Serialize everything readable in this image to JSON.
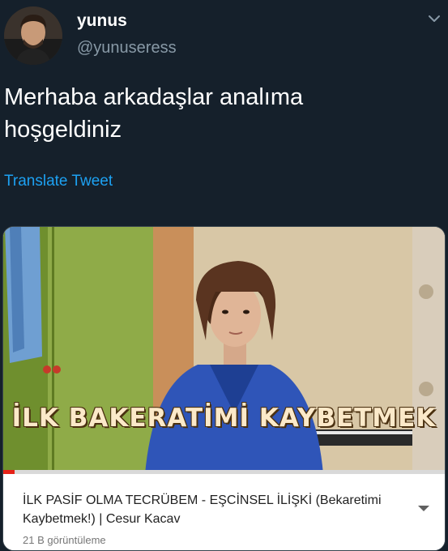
{
  "tweet": {
    "author_name": "yunus",
    "author_handle": "@yunuseress",
    "text": "Merhaba arkadaşlar analıma hoşgeldiniz",
    "translate_label": "Translate Tweet"
  },
  "video_card": {
    "thumbnail_caption": "İLK BAKERATİMİ KAYBETMEK",
    "title": "İLK PASİF OLMA TECRÜBEM - EŞCİNSEL İLİŞKİ (Bekaretimi Kaybetmek!)  | Cesur Kacav",
    "views": "21 B görüntüleme",
    "progress_fraction": 0.025
  },
  "colors": {
    "background": "#15202b",
    "link": "#1da1f2",
    "secondary_text": "#8899a6",
    "progress": "#e62117"
  },
  "icons": {
    "menu": "chevron-down-icon",
    "expand": "dropdown-arrow-icon"
  }
}
